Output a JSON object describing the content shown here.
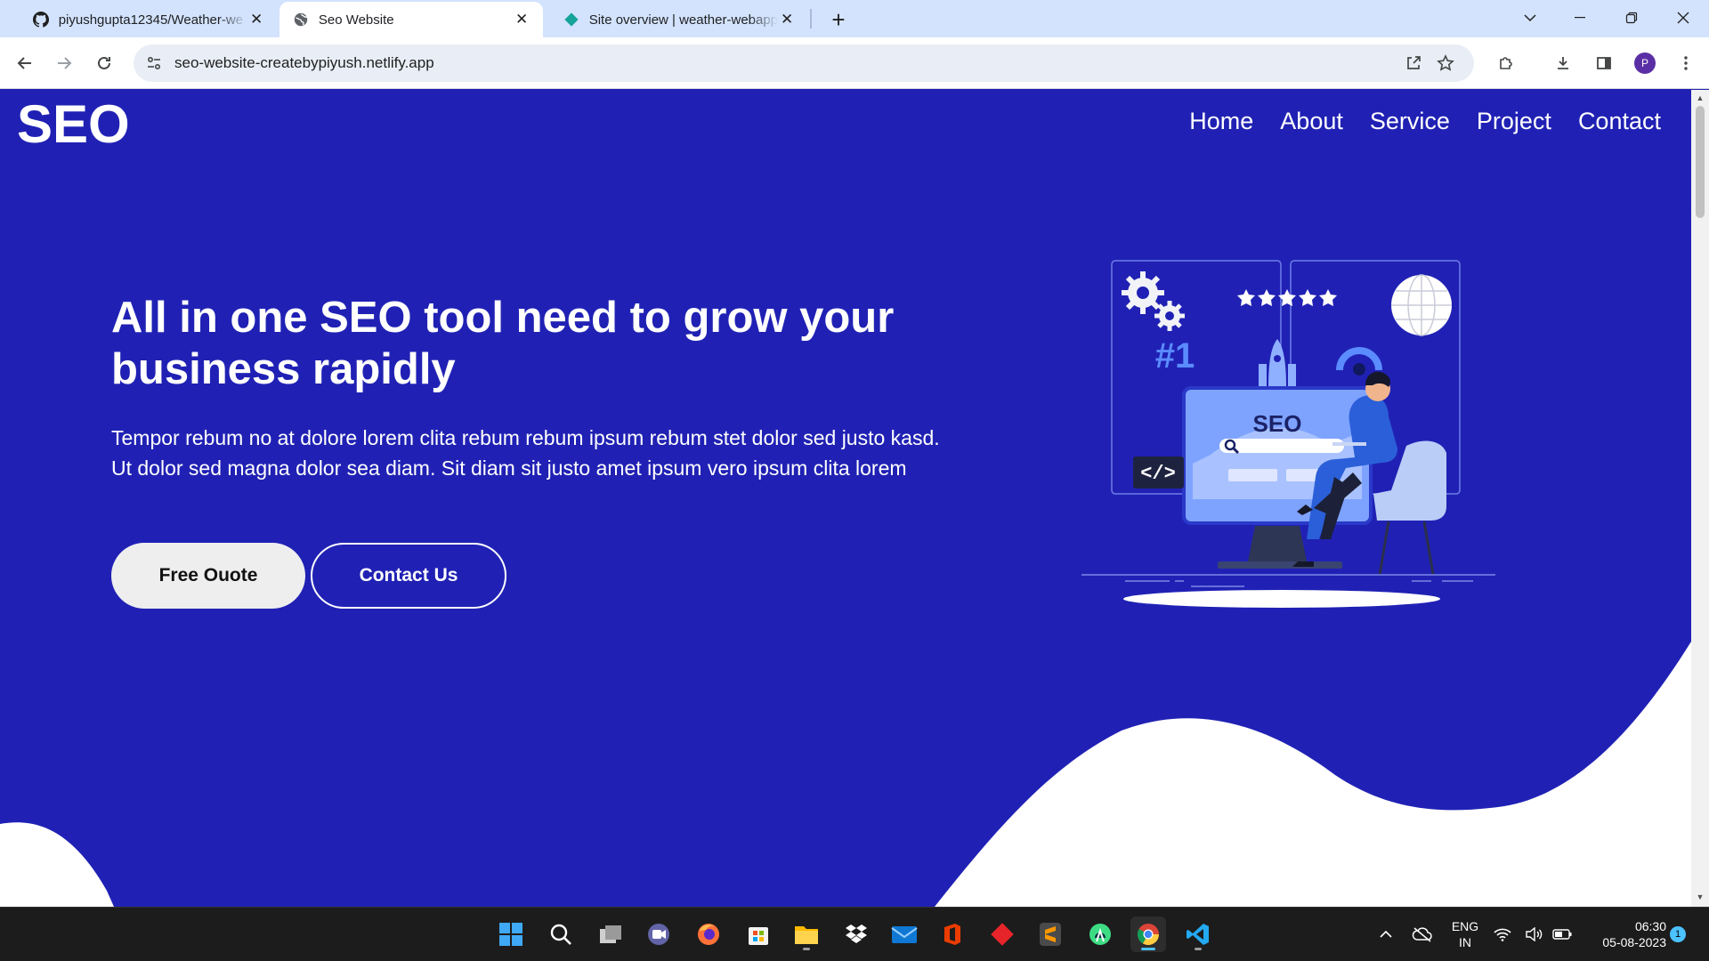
{
  "browser": {
    "tabs": [
      {
        "title": "piyushgupta12345/Weather-we",
        "icon": "github-icon",
        "active": false
      },
      {
        "title": "Seo Website",
        "icon": "globe-icon",
        "active": true
      },
      {
        "title": "Site overview | weather-webapp",
        "icon": "netlify-icon",
        "active": false
      }
    ],
    "url": "seo-website-createbypiyush.netlify.app",
    "profile_initial": "P"
  },
  "site": {
    "logo": "SEO",
    "nav": [
      "Home",
      "About",
      "Service",
      "Project",
      "Contact"
    ],
    "hero": {
      "title": "All in one SEO tool need to grow your business rapidly",
      "text": "Tempor rebum no at dolore lorem clita rebum rebum ipsum rebum stet dolor sed justo kasd. Ut dolor sed magna dolor sea diam. Sit diam sit justo amet ipsum vero ipsum clita lorem",
      "primary_button": "Free Ouote",
      "secondary_button": "Contact Us"
    },
    "illustration": {
      "badge": "#1",
      "screen_label": "SEO",
      "code_tag": "</>"
    },
    "colors": {
      "background": "#2021b4",
      "accent": "#5b8cff",
      "button_light": "#eeeeef"
    }
  },
  "taskbar": {
    "apps": [
      "windows-start",
      "search",
      "task-view",
      "teams",
      "firefox",
      "microsoft-store",
      "file-explorer",
      "dropbox",
      "mail",
      "office",
      "git",
      "sublime-text",
      "android-studio",
      "chrome",
      "vscode"
    ],
    "language": "ENG",
    "region": "IN",
    "time": "06:30",
    "date": "05-08-2023",
    "notification_count": "1"
  }
}
